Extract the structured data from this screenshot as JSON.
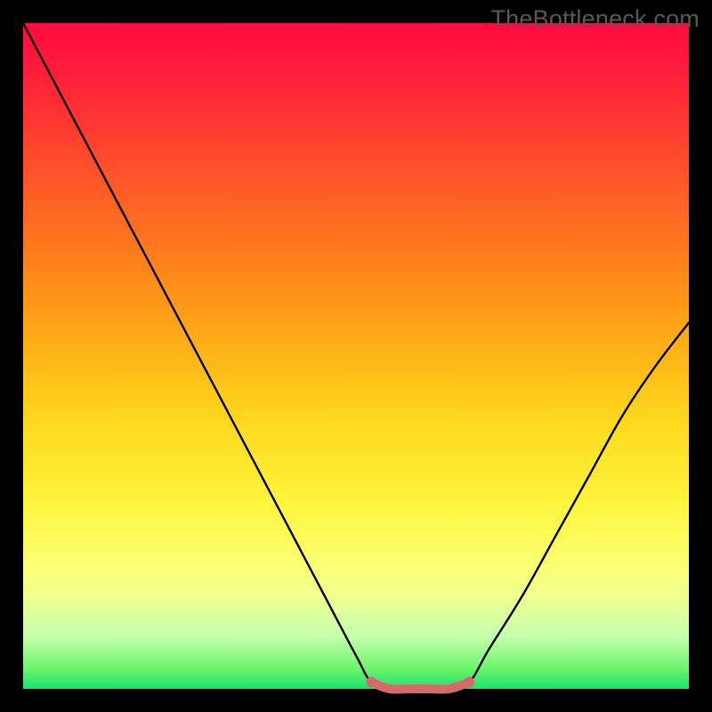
{
  "watermark": "TheBottleneck.com",
  "chart_data": {
    "type": "line",
    "title": "",
    "xlabel": "",
    "ylabel": "",
    "xlim": [
      0,
      1
    ],
    "ylim": [
      0,
      1
    ],
    "series": [
      {
        "name": "bottleneck-curve",
        "x": [
          0.0,
          0.05,
          0.1,
          0.15,
          0.2,
          0.25,
          0.3,
          0.35,
          0.4,
          0.45,
          0.5,
          0.523,
          0.55,
          0.58,
          0.61,
          0.64,
          0.67,
          0.7,
          0.75,
          0.8,
          0.85,
          0.9,
          0.95,
          1.0
        ],
        "y": [
          1.0,
          0.905,
          0.81,
          0.715,
          0.62,
          0.525,
          0.43,
          0.335,
          0.24,
          0.145,
          0.05,
          0.01,
          0.0,
          0.0,
          0.0,
          0.0,
          0.01,
          0.06,
          0.14,
          0.23,
          0.32,
          0.41,
          0.485,
          0.55
        ]
      },
      {
        "name": "floor-highlight",
        "x": [
          0.523,
          0.55,
          0.58,
          0.61,
          0.64,
          0.67
        ],
        "y": [
          0.01,
          0.0,
          0.0,
          0.0,
          0.0,
          0.01
        ]
      }
    ],
    "colors": {
      "curve": "#000000",
      "floor": "#d46a6a"
    }
  }
}
